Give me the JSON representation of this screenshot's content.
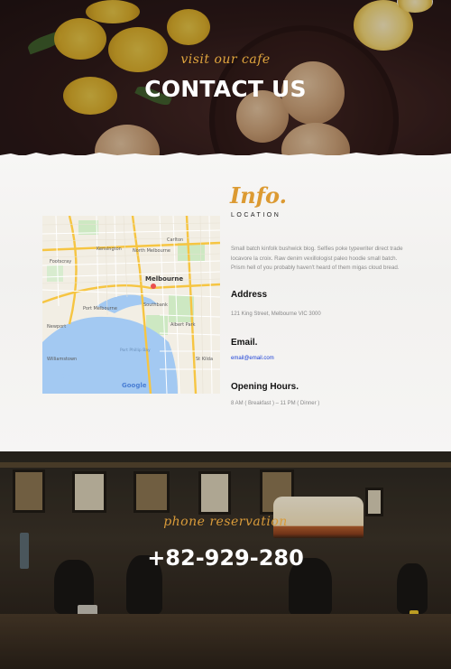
{
  "hero": {
    "script": "visit our cafe",
    "title": "CONTACT US"
  },
  "info": {
    "script": "Info.",
    "subtitle": "LOCATION",
    "description": "Small batch kinfolk bushwick blog. Selfies poke typewriter direct trade locavore la croix. Raw denim vexillologist paleo hoodie small batch. Prism hell of you probably haven't heard of them migas cloud bread."
  },
  "address": {
    "heading": "Address",
    "value": "121 King Street, Melbourne VIC 3000"
  },
  "email": {
    "heading": "Email.",
    "value": "email@email.com"
  },
  "hours": {
    "heading": "Opening Hours.",
    "value": "8 AM ( Breakfast ) – 11 PM ( Dinner )"
  },
  "map": {
    "labels": {
      "melbourne": "Melbourne",
      "southbank": "Southbank",
      "port_melbourne": "Port Melbourne",
      "albert_park": "Albert Park",
      "williamstown": "Williamstown",
      "newport": "Newport",
      "footscray": "Footscray",
      "st_kilda": "St Kilda",
      "carlton": "Carlton",
      "north_melbourne": "North Melbourne",
      "kensington": "Kensington",
      "port_phillip_bay": "Port Phillip Bay",
      "google": "Google"
    }
  },
  "reservation": {
    "script": "phone reservation",
    "phone": "+82-929-280"
  },
  "colors": {
    "accent": "#dc9a32",
    "link": "#1a3fd6",
    "water": "#a3c9f2"
  }
}
